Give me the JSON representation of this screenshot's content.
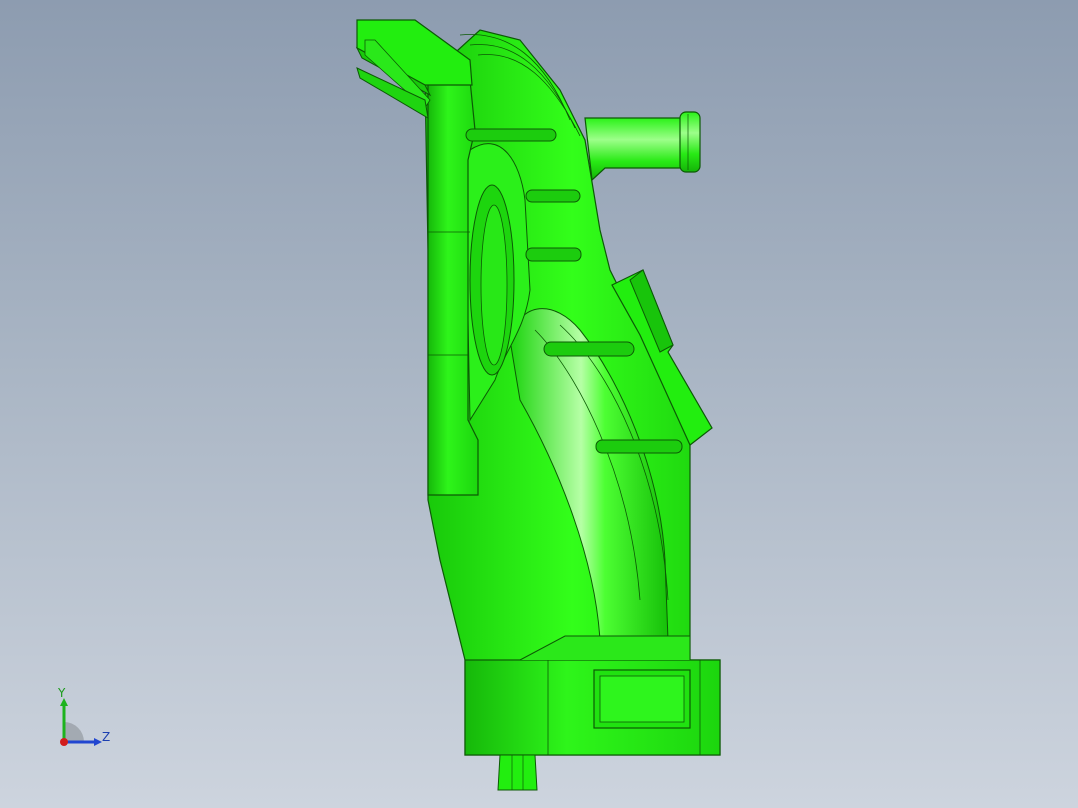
{
  "viewport": {
    "background_top": "#8d9cb0",
    "background_bottom": "#cdd4de"
  },
  "model": {
    "part_color": "#22ee0f",
    "edge_color": "#0c5a05",
    "highlight_color": "#c8ffbe"
  },
  "triad": {
    "y_label": "Y",
    "z_label": "Z",
    "y_color": "#1db31d",
    "z_color": "#2146d0",
    "x_color": "#d21c1c"
  }
}
